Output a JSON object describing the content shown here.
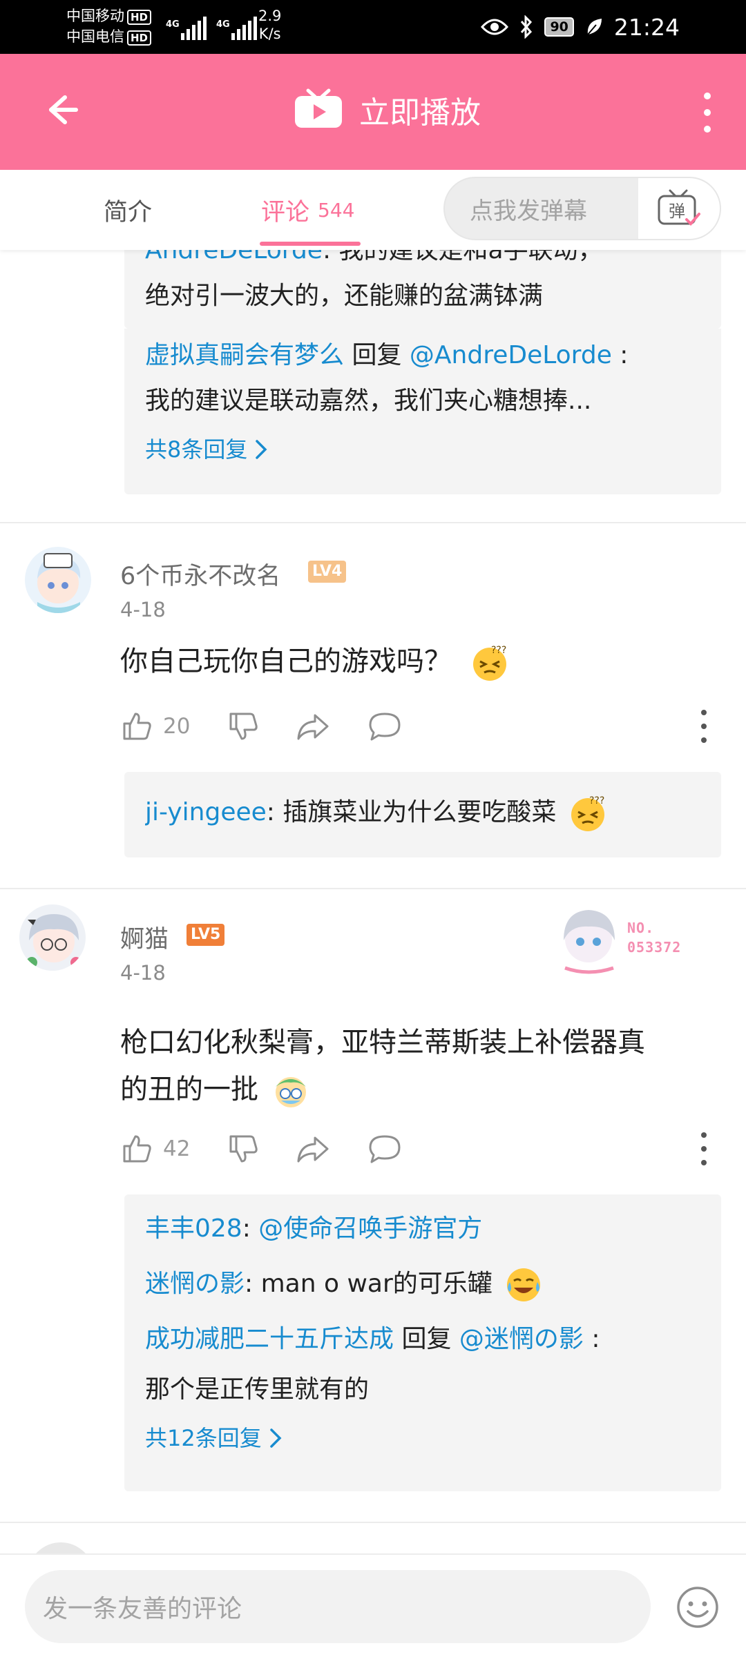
{
  "status_bar": {
    "carrier_1": "中国移动",
    "carrier_2": "中国电信",
    "hd": "HD",
    "net_1": "4G",
    "net_2": "4G",
    "speed_value": "2.9",
    "speed_unit": "K/s",
    "battery": "90",
    "time": "21:24"
  },
  "header": {
    "title": "立即播放",
    "icon": "tv-play-icon",
    "accent": "#fb7299"
  },
  "tabs": [
    {
      "label": "简介",
      "count": ""
    },
    {
      "label": "评论",
      "count": "544"
    }
  ],
  "danmaku": {
    "placeholder": "点我发弹幕",
    "toggle_label": "弹"
  },
  "thread_top": {
    "line_1_user": "AndreDeLorde",
    "line_1_text": ": 我的建议是和a手联动，",
    "line_2_text": "绝对引一波大的，还能赚的盆满钵满",
    "line_3_user": "虚拟真嗣会有梦么",
    "line_3_reply": " 回复 ",
    "line_3_mention": "@AndreDeLorde",
    "line_3_colon": " :",
    "line_4_text": "我的建议是联动嘉然，我们夹心糖想捧...",
    "more": "共8条回复"
  },
  "comments": [
    {
      "username": "6个币永不改名",
      "level": "LV4",
      "level_color": "#f6b26b",
      "date": "4-18",
      "body": "你自己玩你自己的游戏吗？",
      "likes": "20",
      "replies": [
        {
          "user": "ji-yingeee",
          "text": ": 插旗菜业为什么要吃酸菜"
        }
      ]
    },
    {
      "username": "婀猫",
      "level": "LV5",
      "level_color": "#f07f38",
      "date": "4-18",
      "body_line_1": "枪口幻化秋梨膏，亚特兰蒂斯装上补偿器真",
      "body_line_2": "的丑的一批",
      "likes": "42",
      "fan_badge_no": "NO.",
      "fan_badge_num": "053372",
      "replies": [
        {
          "user": "丰丰028",
          "text": ": ",
          "mention": "@使命召唤手游官方"
        },
        {
          "user": "迷惘の影",
          "text": ": man o war的可乐罐"
        },
        {
          "user": "成功减肥二十五斤达成",
          "reply": " 回复 ",
          "mention": "@迷惘の影",
          "colon": " :"
        },
        {
          "text": "那个是正传里就有的"
        }
      ],
      "more": "共12条回复"
    }
  ],
  "bottom": {
    "placeholder": "发一条友善的评论",
    "emoji_icon": "smiley-icon"
  }
}
